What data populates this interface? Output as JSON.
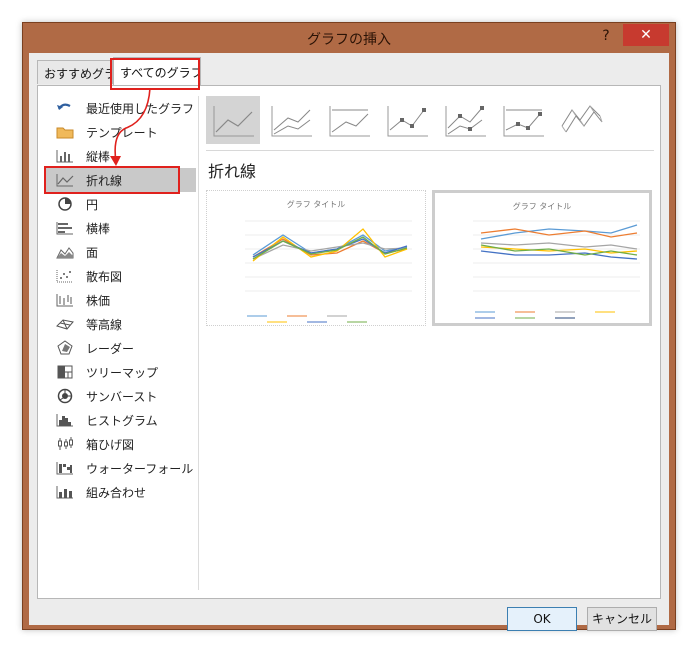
{
  "window": {
    "title": "グラフの挿入",
    "help": "?",
    "close": "✕"
  },
  "tabs": [
    {
      "label": "おすすめグラフ",
      "active": false
    },
    {
      "label": "すべてのグラフ",
      "active": true
    }
  ],
  "chart_types": [
    {
      "label": "最近使用したグラフ",
      "icon": "undo-arrow-icon"
    },
    {
      "label": "テンプレート",
      "icon": "folder-icon"
    },
    {
      "label": "縦棒",
      "icon": "column-chart-icon"
    },
    {
      "label": "折れ線",
      "icon": "line-chart-icon",
      "selected": true
    },
    {
      "label": "円",
      "icon": "pie-chart-icon"
    },
    {
      "label": "横棒",
      "icon": "bar-chart-icon"
    },
    {
      "label": "面",
      "icon": "area-chart-icon"
    },
    {
      "label": "散布図",
      "icon": "scatter-chart-icon"
    },
    {
      "label": "株価",
      "icon": "stock-chart-icon"
    },
    {
      "label": "等高線",
      "icon": "surface-chart-icon"
    },
    {
      "label": "レーダー",
      "icon": "radar-chart-icon"
    },
    {
      "label": "ツリーマップ",
      "icon": "treemap-icon"
    },
    {
      "label": "サンバースト",
      "icon": "sunburst-icon"
    },
    {
      "label": "ヒストグラム",
      "icon": "histogram-icon"
    },
    {
      "label": "箱ひげ図",
      "icon": "box-whisker-icon"
    },
    {
      "label": "ウォーターフォール",
      "icon": "waterfall-icon"
    },
    {
      "label": "組み合わせ",
      "icon": "combo-chart-icon"
    }
  ],
  "subtypes": [
    {
      "icon": "line-icon",
      "selected": true
    },
    {
      "icon": "stacked-line-icon"
    },
    {
      "icon": "100-stacked-line-icon"
    },
    {
      "icon": "line-markers-icon"
    },
    {
      "icon": "stacked-line-markers-icon"
    },
    {
      "icon": "100-stacked-line-markers-icon"
    },
    {
      "icon": "3d-line-icon"
    }
  ],
  "selected_type_title": "折れ線",
  "previews": [
    {
      "title": "グラフ タイトル",
      "selected": false
    },
    {
      "title": "グラフ タイトル",
      "selected": true
    }
  ],
  "buttons": {
    "ok": "OK",
    "cancel": "キャンセル"
  },
  "colors": {
    "title_bar": "#b06a45",
    "close_button": "#c73a2f",
    "annotation": "#e0211d",
    "selection": "#c9c9c9",
    "ok_border": "#3c7fb1"
  }
}
